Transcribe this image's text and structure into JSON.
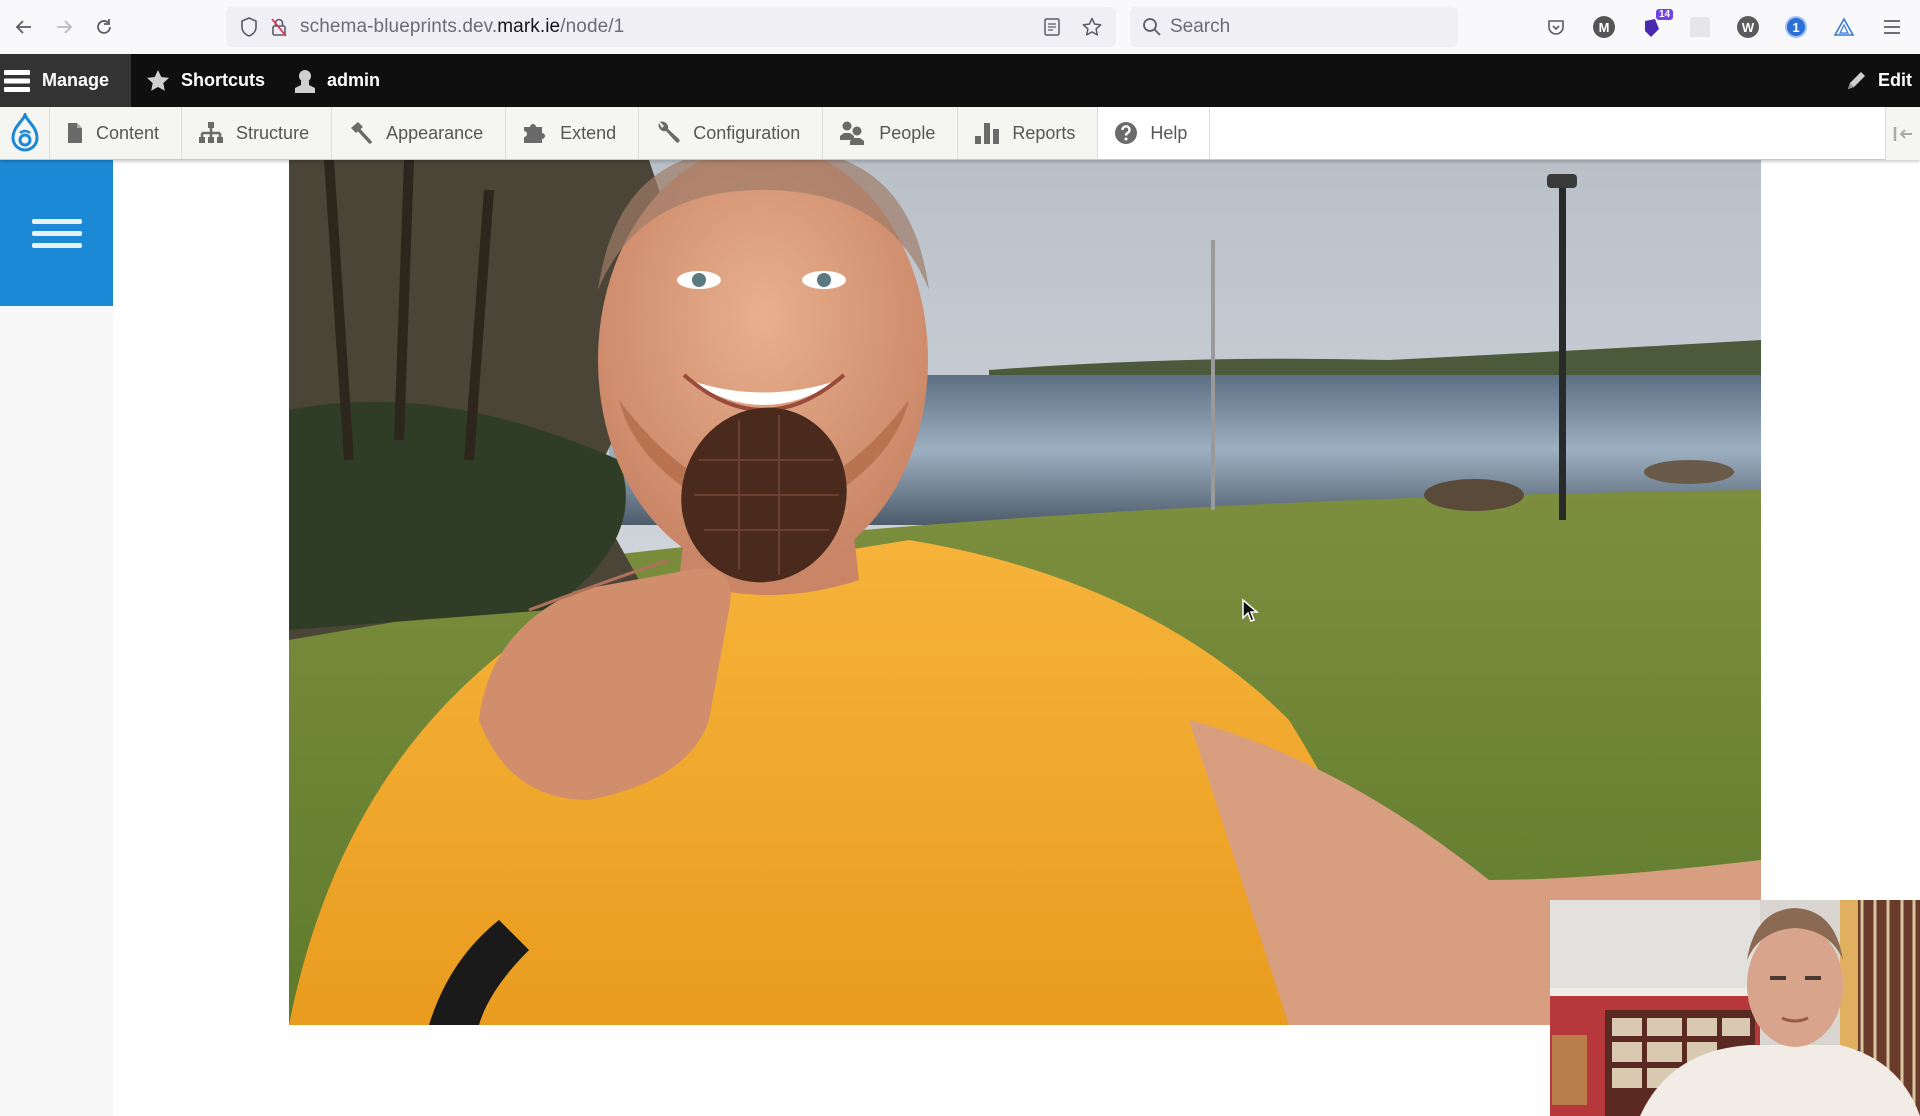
{
  "browser": {
    "url_prefix": "schema-blueprints.dev.",
    "url_domain": "mark.ie",
    "url_path": "/node/1",
    "search_placeholder": "Search",
    "nav": {
      "back_icon": "arrow-left-icon",
      "forward_icon": "arrow-right-icon",
      "reload_icon": "reload-icon"
    },
    "extensions": [
      {
        "name": "pocket-icon"
      },
      {
        "name": "m-extension-icon",
        "glyph": "M"
      },
      {
        "name": "tab-manager-icon",
        "badge": "14"
      },
      {
        "name": "blank-extension-icon"
      },
      {
        "name": "wordpress-icon",
        "glyph": "W"
      },
      {
        "name": "onepassword-icon",
        "glyph": "1"
      },
      {
        "name": "triangle-extension-icon"
      }
    ]
  },
  "admin_bar": {
    "manage_label": "Manage",
    "shortcuts_label": "Shortcuts",
    "user_label": "admin",
    "edit_label": "Edit"
  },
  "tray": {
    "items": [
      {
        "label": "Content",
        "icon": "file-icon"
      },
      {
        "label": "Structure",
        "icon": "sitemap-icon"
      },
      {
        "label": "Appearance",
        "icon": "paintbrush-icon"
      },
      {
        "label": "Extend",
        "icon": "puzzle-icon"
      },
      {
        "label": "Configuration",
        "icon": "wrench-icon"
      },
      {
        "label": "People",
        "icon": "people-icon"
      },
      {
        "label": "Reports",
        "icon": "bar-chart-icon"
      },
      {
        "label": "Help",
        "icon": "help-icon"
      }
    ]
  },
  "content": {
    "image_alt": "Smiling man in orange t-shirt holding a chocolate biscuit by a lake",
    "webcam_alt": "Webcam overlay of presenter in front of bookshelf"
  },
  "colors": {
    "drupal_blue": "#1b89d5",
    "admin_bar_bg": "#0f0f0f",
    "tray_bg": "#f5f5f2"
  }
}
